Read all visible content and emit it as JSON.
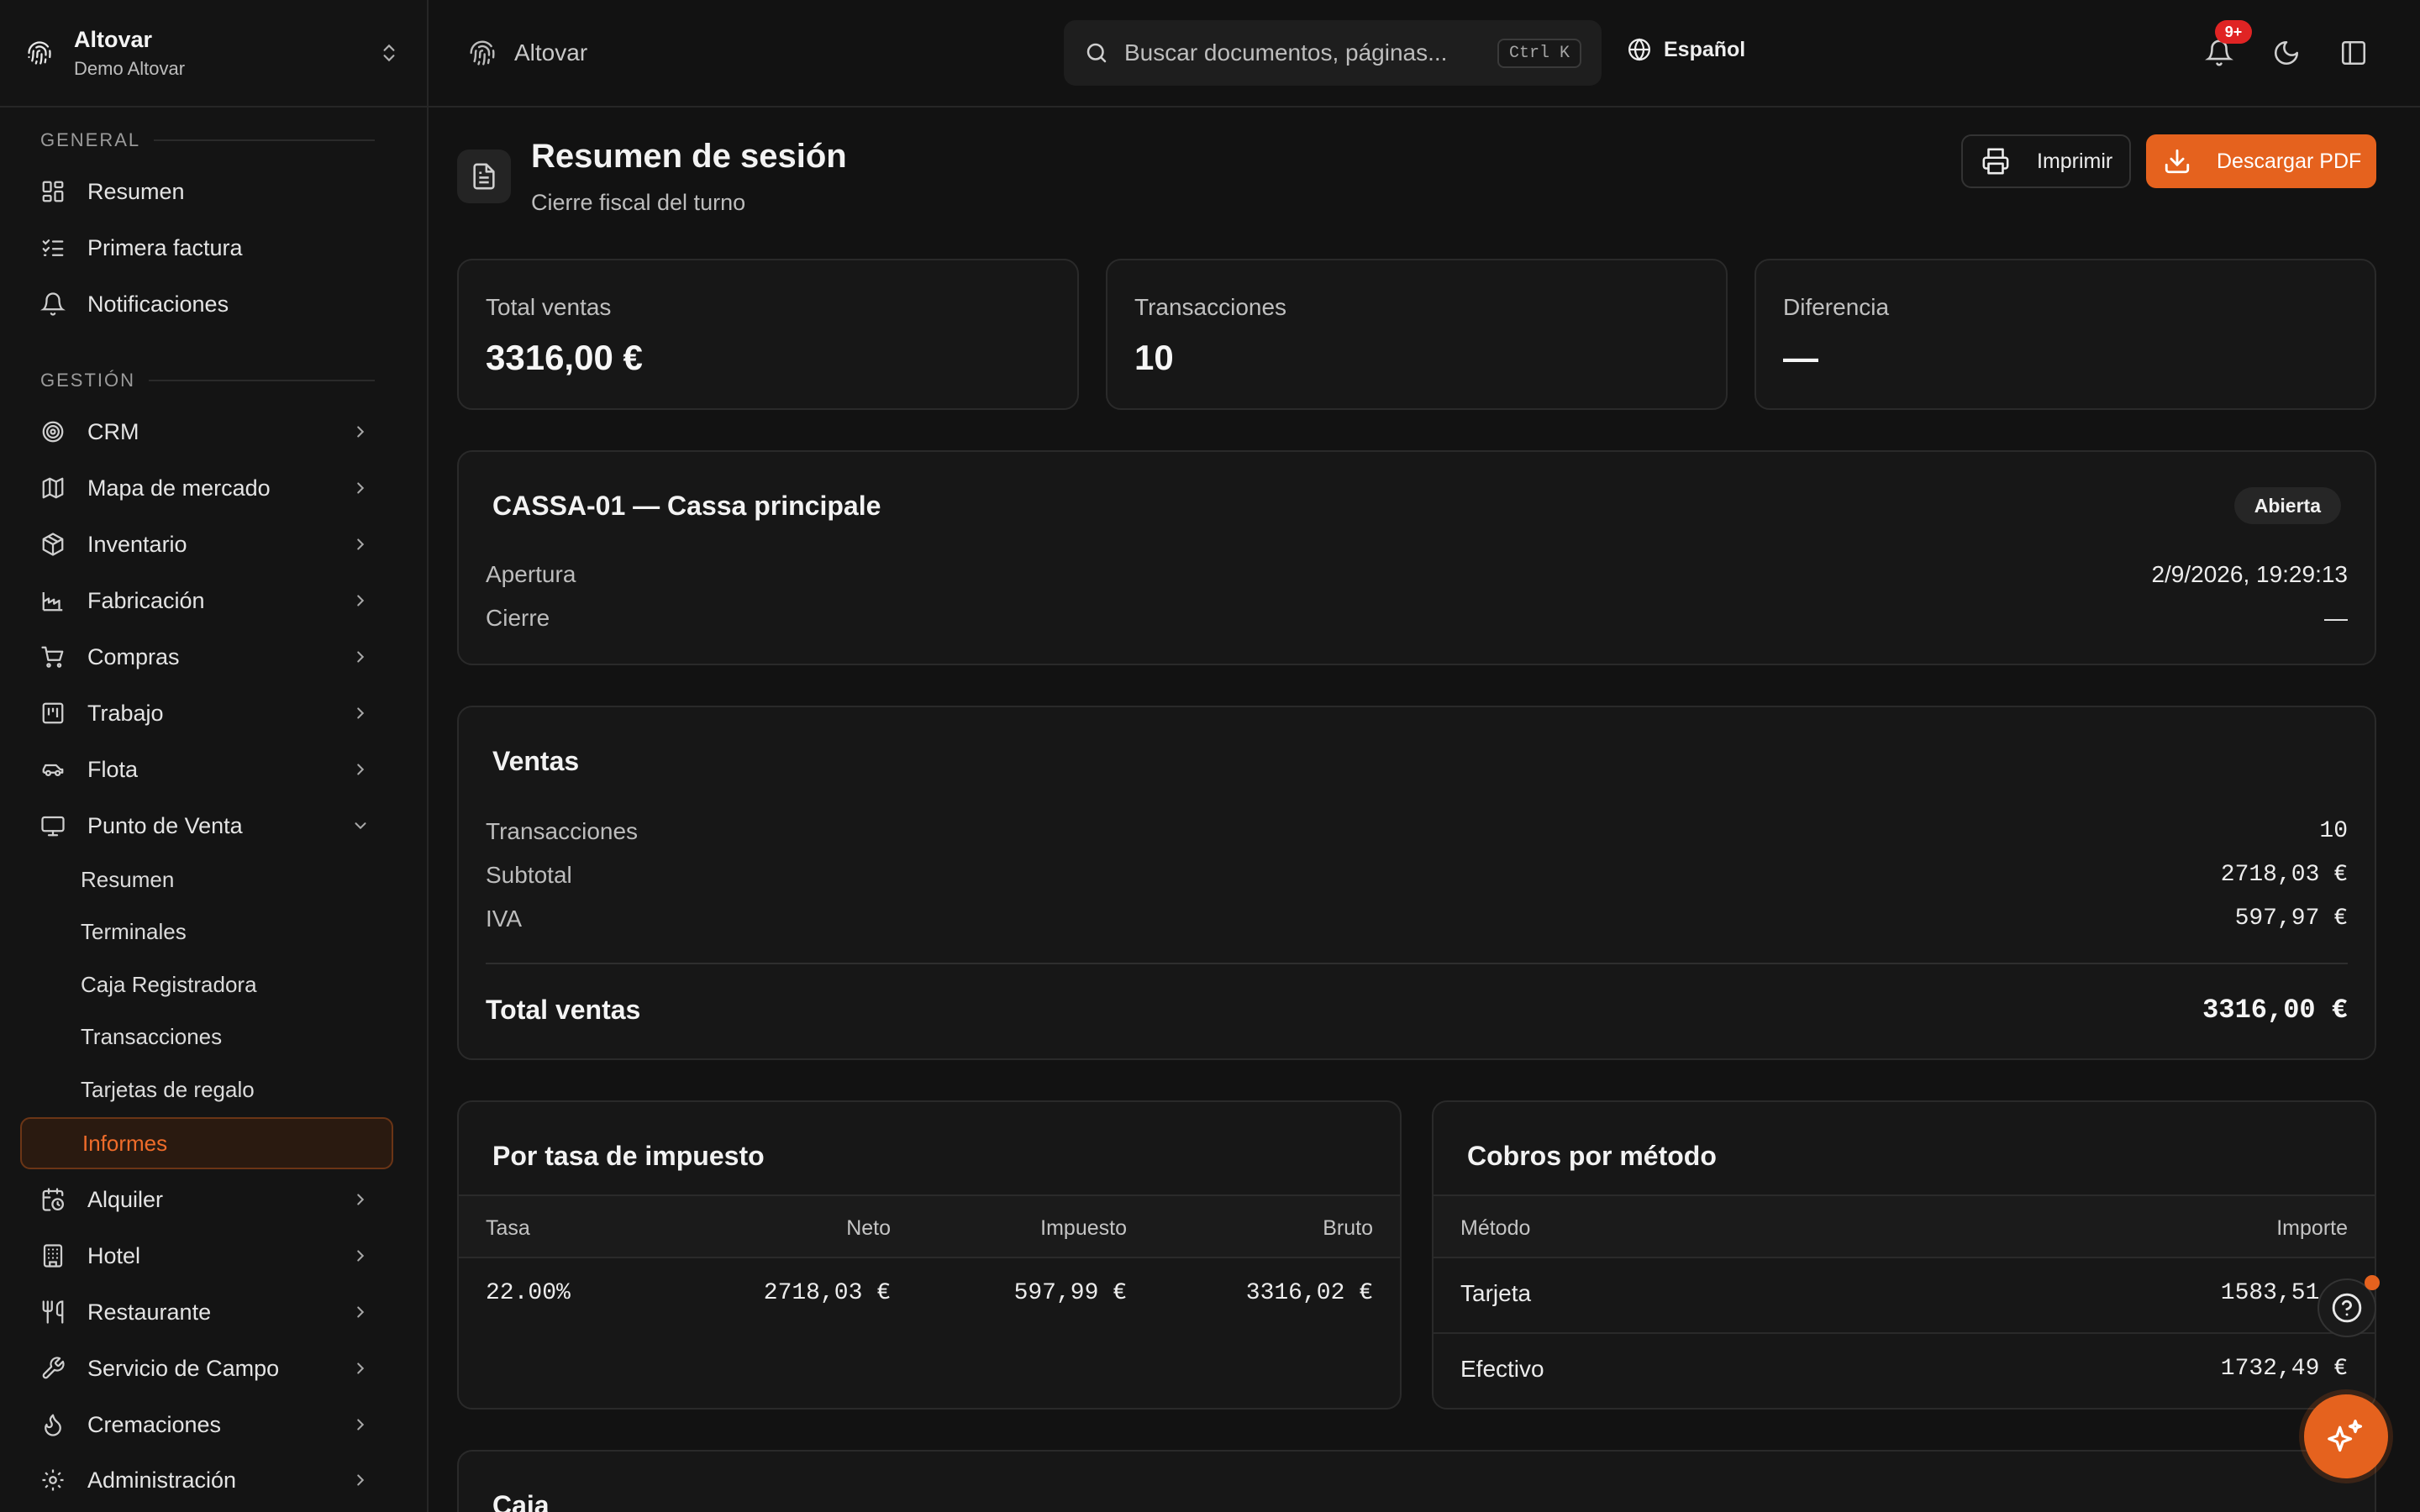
{
  "brand": {
    "org": "Altovar",
    "workspace": "Demo Altovar"
  },
  "sidebar": {
    "general_label": "GENERAL",
    "general": [
      {
        "label": "Resumen",
        "icon": "dashboard-icon"
      },
      {
        "label": "Primera factura",
        "icon": "checklist-icon"
      },
      {
        "label": "Notificaciones",
        "icon": "bell-icon"
      }
    ],
    "gestion_label": "GESTIÓN",
    "gestion": [
      {
        "label": "CRM",
        "icon": "target-icon"
      },
      {
        "label": "Mapa de mercado",
        "icon": "map-icon"
      },
      {
        "label": "Inventario",
        "icon": "box-icon"
      },
      {
        "label": "Fabricación",
        "icon": "factory-icon"
      },
      {
        "label": "Compras",
        "icon": "cart-icon"
      },
      {
        "label": "Trabajo",
        "icon": "kanban-icon"
      },
      {
        "label": "Flota",
        "icon": "car-icon"
      },
      {
        "label": "Punto de Venta",
        "icon": "monitor-icon"
      }
    ],
    "pos_sub": [
      "Resumen",
      "Terminales",
      "Caja Registradora",
      "Transacciones",
      "Tarjetas de regalo",
      "Informes"
    ],
    "gestion_more": [
      {
        "label": "Alquiler",
        "icon": "calendar-clock-icon"
      },
      {
        "label": "Hotel",
        "icon": "building-icon"
      },
      {
        "label": "Restaurante",
        "icon": "utensils-icon"
      },
      {
        "label": "Servicio de Campo",
        "icon": "wrench-icon"
      },
      {
        "label": "Cremaciones",
        "icon": "flame-icon"
      },
      {
        "label": "Administración",
        "icon": "gear-icon"
      }
    ]
  },
  "header": {
    "breadcrumb": "Altovar",
    "search_placeholder": "Buscar documentos, páginas...",
    "shortcut": "Ctrl K",
    "language": "Español",
    "notifications_badge": "9+"
  },
  "page": {
    "title": "Resumen de sesión",
    "subtitle": "Cierre fiscal del turno",
    "print_label": "Imprimir",
    "pdf_label": "Descargar PDF",
    "accent": "#e5621e"
  },
  "stats": [
    {
      "label": "Total ventas",
      "value": "3316,00 €"
    },
    {
      "label": "Transacciones",
      "value": "10"
    },
    {
      "label": "Diferencia",
      "value": "—"
    }
  ],
  "register": {
    "title": "CASSA-01 — Cassa principale",
    "status": "Abierta",
    "opening_label": "Apertura",
    "opening_value": "2/9/2026, 19:29:13",
    "closing_label": "Cierre",
    "closing_value": "—"
  },
  "sales": {
    "title": "Ventas",
    "rows": [
      {
        "label": "Transacciones",
        "value": "10"
      },
      {
        "label": "Subtotal",
        "value": "2718,03 €"
      },
      {
        "label": "IVA",
        "value": "597,97 €"
      }
    ],
    "total_label": "Total ventas",
    "total_value": "3316,00 €"
  },
  "tax": {
    "title": "Por tasa de impuesto",
    "headers": [
      "Tasa",
      "Neto",
      "Impuesto",
      "Bruto"
    ],
    "rows": [
      [
        "22.00%",
        "2718,03 €",
        "597,99 €",
        "3316,02 €"
      ]
    ]
  },
  "payments": {
    "title": "Cobros por método",
    "headers": [
      "Método",
      "Importe"
    ],
    "rows": [
      [
        "Tarjeta",
        "1583,51 €"
      ],
      [
        "Efectivo",
        "1732,49 €"
      ]
    ]
  },
  "cash": {
    "title": "Caja"
  }
}
